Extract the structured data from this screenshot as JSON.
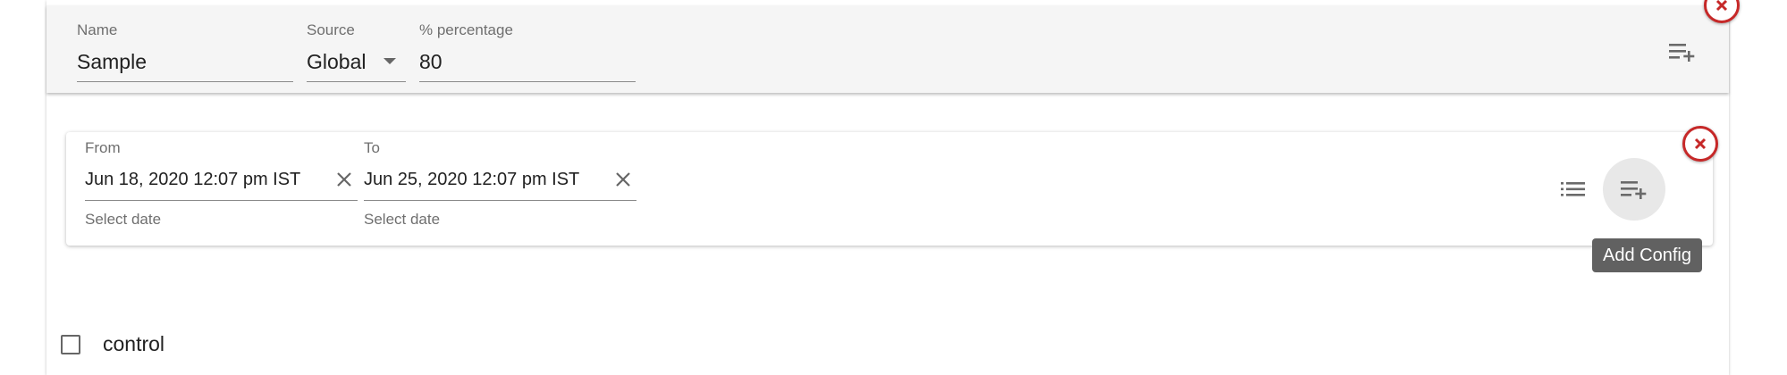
{
  "config_panel": {
    "name": {
      "label": "Name",
      "value": "Sample"
    },
    "source": {
      "label": "Source",
      "value": "Global"
    },
    "percentage": {
      "label": "% percentage",
      "value": "80"
    }
  },
  "date_range": {
    "from": {
      "label": "From",
      "value": "Jun 18, 2020 12:07 pm IST",
      "hint": "Select date"
    },
    "to": {
      "label": "To",
      "value": "Jun 25, 2020 12:07 pm IST",
      "hint": "Select date"
    }
  },
  "tooltip": {
    "text": "Add Config"
  },
  "checkbox": {
    "label": "control",
    "checked": false
  },
  "icons": {
    "top_add": "playlist-add-icon",
    "list": "list-icon",
    "add_config": "playlist-add-icon",
    "remove": "close-circle-icon",
    "clear": "close-icon",
    "dropdown": "arrow-drop-down-icon"
  },
  "colors": {
    "danger": "#c62828",
    "panel": "#f5f5f5",
    "tooltip": "#616161"
  }
}
